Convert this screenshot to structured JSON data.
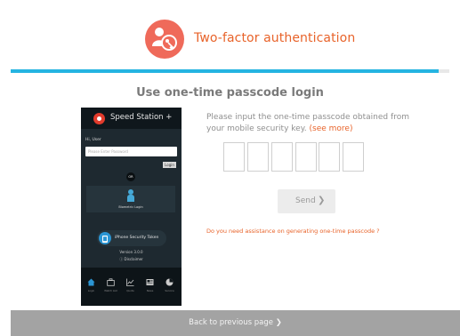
{
  "header": {
    "title": "Two-factor authentication",
    "logo_icon": "user-key-icon",
    "accent": "#e8632a",
    "progress_fraction": 0.975
  },
  "main": {
    "title": "Use one-time passcode login",
    "instruction": "Please input the one-time passcode obtained from your mobile security key.",
    "see_more_link": "(see more)",
    "code_boxes": [
      "",
      "",
      "",
      "",
      "",
      ""
    ],
    "send_label": "Send",
    "assist_link": "Do you need assistance on generating one-time passcode ?"
  },
  "phone": {
    "app_name": "Speed Station +",
    "greeting": "Hi, User",
    "password_placeholder": "Please Enter Password",
    "login_label": "Login",
    "or_label": "OR",
    "biometric_label": "Biometric Login",
    "token_label": "iPhone Security Token",
    "version": "Version  3.0.0",
    "disclaimer": "ⓘ Disclaimer",
    "tabs": [
      {
        "label": "Login",
        "icon": "home-icon"
      },
      {
        "label": "Watch List",
        "icon": "briefcase-icon"
      },
      {
        "label": "Quote",
        "icon": "chart-icon"
      },
      {
        "label": "News",
        "icon": "news-icon"
      },
      {
        "label": "Service",
        "icon": "pie-icon"
      }
    ]
  },
  "footer": {
    "back_label": "Back to previous page"
  }
}
